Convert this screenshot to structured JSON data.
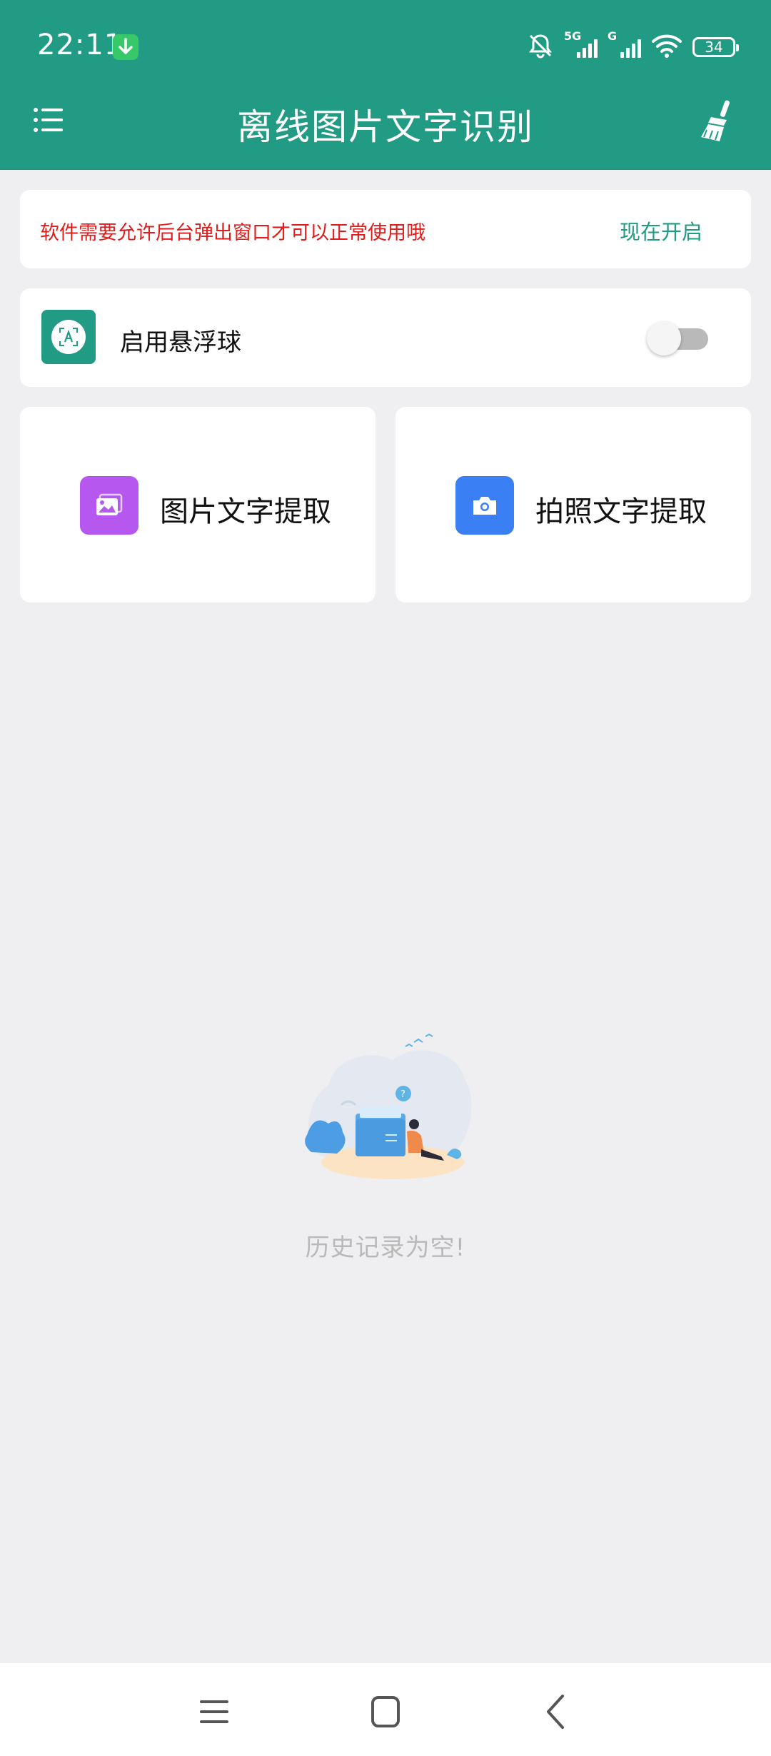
{
  "status_bar": {
    "time": "22:11",
    "network_tag_1": "5G",
    "network_tag_2": "G",
    "battery": "34"
  },
  "app_bar": {
    "title": "离线图片文字识别",
    "menu_icon": "menu-icon",
    "clean_icon": "broom-icon"
  },
  "notice": {
    "text": "软件需要允许后台弹出窗口才可以正常使用哦",
    "action": "现在开启",
    "text_color": "#e01c1c",
    "action_color": "#229b85"
  },
  "floating_ball": {
    "label": "启用悬浮球",
    "enabled": false
  },
  "actions": [
    {
      "label": "图片文字提取",
      "icon": "image-icon",
      "color": "#b657f0"
    },
    {
      "label": "拍照文字提取",
      "icon": "camera-icon",
      "color": "#3b7ff4"
    }
  ],
  "history": {
    "empty_text": "历史记录为空!"
  },
  "nav_bar": {
    "items": [
      "menu-icon",
      "home-icon",
      "back-icon"
    ]
  },
  "colors": {
    "primary": "#229b85",
    "background": "#efeff1"
  }
}
